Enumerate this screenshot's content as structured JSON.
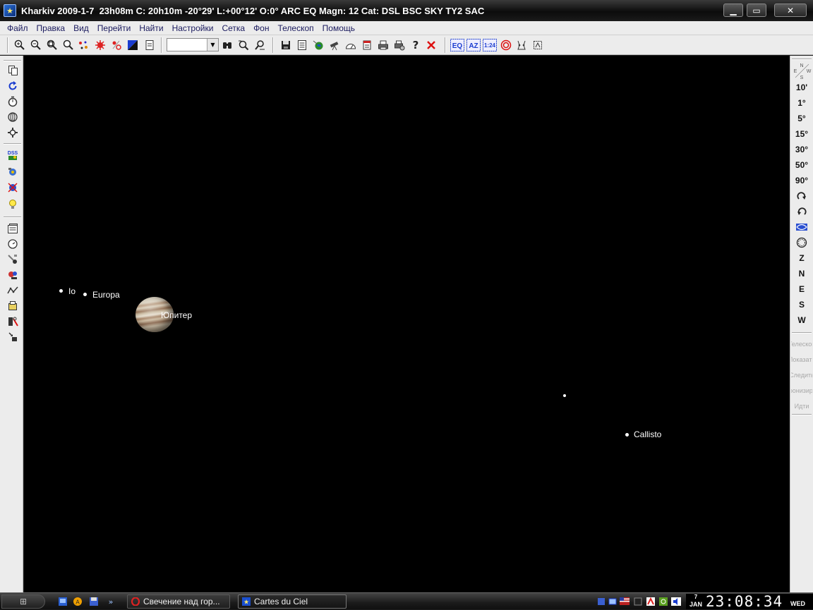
{
  "window": {
    "title": "Kharkiv 2009-1-7  23h08m C: 20h10m -20°29' L:+00°12' O:0° ARC EQ Magn: 12 Cat: DSL BSC SKY TY2 SAC",
    "minimize_icon": "minimize-icon",
    "maximize_icon": "maximize-icon",
    "close_icon": "close-icon"
  },
  "menu": [
    "Файл",
    "Правка",
    "Вид",
    "Перейти",
    "Найти",
    "Настройки",
    "Сетка",
    "Фон",
    "Телескоп",
    "Помощь"
  ],
  "toolbar": {
    "fov_combo_value": "",
    "help_glyph": "?",
    "eq_label": "EQ",
    "az_label": "AZ",
    "h24_label": "1:24",
    "icons": [
      "zoom-in-icon",
      "zoom-out-icon",
      "zoom-fit-icon",
      "zoom-search-icon",
      "stars-icon",
      "nebula-icon",
      "planet-icon",
      "reverse-colors-icon",
      "new-page-icon",
      "binoculars-icon",
      "search-object-icon",
      "find-icon",
      "save-icon",
      "list-icon",
      "globe-icon",
      "telescope-icon",
      "horizon-icon",
      "calendar-icon",
      "print-icon",
      "printer-setup-icon",
      "help-icon",
      "close-chart-icon",
      "eq-grid-icon",
      "az-grid-icon",
      "24h-icon",
      "target-icon",
      "constellation-icon",
      "frame-icon"
    ]
  },
  "left_toolbar": {
    "dss_label": "DSS",
    "icons": [
      "copy-icon",
      "refresh-icon",
      "timer-icon",
      "animation-icon",
      "settings-icon",
      "dss-image-icon",
      "show-images-icon",
      "mirror-icon",
      "bulb-icon",
      "catalog-icon",
      "clock-icon",
      "comet-icon",
      "asteroid-icon",
      "line-icon",
      "calculator-icon",
      "tools-icon",
      "export-icon"
    ]
  },
  "right_toolbar": {
    "fov_buttons": [
      "10'",
      "1°",
      "5°",
      "15°",
      "30°",
      "50°",
      "90°"
    ],
    "direction_buttons": [
      "Z",
      "N",
      "E",
      "S",
      "W"
    ],
    "telescope_buttons": [
      "Телескоп",
      "Показать",
      "Следить",
      "Синхронизировать",
      "Идти"
    ],
    "compass_labels": "N E W S"
  },
  "sky": {
    "objects": [
      {
        "name": "Io",
        "type": "moon"
      },
      {
        "name": "Europa",
        "type": "moon"
      },
      {
        "name": "Юпитер",
        "type": "planet"
      },
      {
        "name": "",
        "type": "star"
      },
      {
        "name": "Callisto",
        "type": "moon"
      }
    ]
  },
  "taskbar": {
    "tasks": [
      "Свечение над гор...",
      "Cartes du Ciel"
    ],
    "clock": {
      "day": "7",
      "month": "JAN",
      "time": "23:08:34",
      "weekday": "WED"
    }
  },
  "colors": {
    "sky_background": "#000000",
    "object_color": "#ffffff",
    "menu_text": "#1a1a5e"
  }
}
